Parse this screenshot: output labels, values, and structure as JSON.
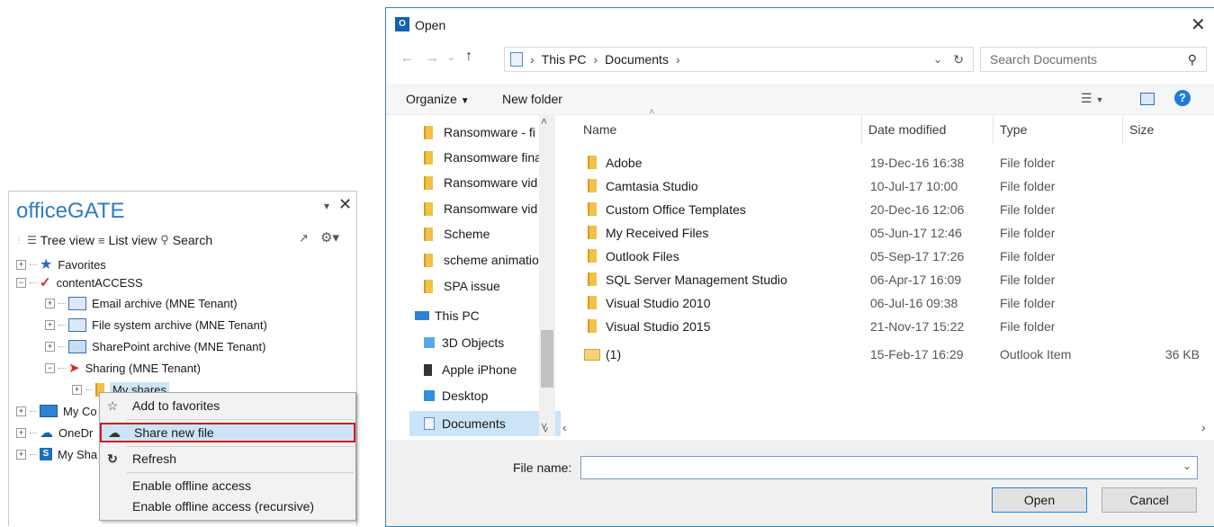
{
  "officegate": {
    "title": "officeGATE",
    "pin_icon": "pin-icon",
    "close_icon": "close-icon",
    "toolbar": {
      "tree_view": "Tree view",
      "list_view": "List view",
      "search": "Search"
    },
    "tree": [
      {
        "label": "Favorites",
        "icon": "star-icon"
      },
      {
        "label": "contentACCESS",
        "icon": "contentaccess-icon"
      },
      {
        "label": "Email archive (MNE Tenant)",
        "icon": "email-archive-icon"
      },
      {
        "label": "File system archive (MNE Tenant)",
        "icon": "filesystem-archive-icon"
      },
      {
        "label": "SharePoint archive (MNE Tenant)",
        "icon": "sharepoint-archive-icon"
      },
      {
        "label": "Sharing (MNE Tenant)",
        "icon": "sharing-icon"
      },
      {
        "label": "My shares",
        "icon": "folder-icon"
      },
      {
        "label": "My Co",
        "icon": "computer-icon"
      },
      {
        "label": "OneDr",
        "icon": "onedrive-icon"
      },
      {
        "label": "My Sha",
        "icon": "sharepoint-icon"
      }
    ]
  },
  "context_menu": {
    "items": [
      {
        "label": "Add to favorites",
        "icon": "star-outline-icon"
      },
      {
        "label": "Share new file",
        "icon": "cloud-upload-icon"
      },
      {
        "label": "Refresh",
        "icon": "refresh-icon"
      },
      {
        "label": "Enable offline access",
        "icon": ""
      },
      {
        "label": "Enable offline access (recursive)",
        "icon": ""
      }
    ]
  },
  "dialog": {
    "title": "Open",
    "address": {
      "crumbs": [
        "This PC",
        "Documents"
      ]
    },
    "search_placeholder": "Search Documents",
    "toolbar": {
      "organize": "Organize",
      "new_folder": "New folder"
    },
    "nav": [
      {
        "label": "Ransomware - fi",
        "type": "folder"
      },
      {
        "label": "Ransomware fina",
        "type": "folder"
      },
      {
        "label": "Ransomware vid",
        "type": "folder"
      },
      {
        "label": "Ransomware vid",
        "type": "folder"
      },
      {
        "label": "Scheme",
        "type": "folder"
      },
      {
        "label": "scheme animatio",
        "type": "folder"
      },
      {
        "label": "SPA issue",
        "type": "folder"
      },
      {
        "label": "This PC",
        "type": "pc"
      },
      {
        "label": "3D Objects",
        "type": "3d"
      },
      {
        "label": "Apple iPhone",
        "type": "phone"
      },
      {
        "label": "Desktop",
        "type": "desktop"
      },
      {
        "label": "Documents",
        "type": "documents"
      }
    ],
    "columns": {
      "name": "Name",
      "date": "Date modified",
      "type": "Type",
      "size": "Size"
    },
    "files": [
      {
        "name": "Adobe",
        "date": "19-Dec-16 16:38",
        "type": "File folder",
        "size": "",
        "icon": "folder-icon"
      },
      {
        "name": "Camtasia Studio",
        "date": "10-Jul-17 10:00",
        "type": "File folder",
        "size": "",
        "icon": "folder-icon"
      },
      {
        "name": "Custom Office Templates",
        "date": "20-Dec-16 12:06",
        "type": "File folder",
        "size": "",
        "icon": "folder-icon"
      },
      {
        "name": "My Received Files",
        "date": "05-Jun-17 12:46",
        "type": "File folder",
        "size": "",
        "icon": "folder-icon"
      },
      {
        "name": "Outlook Files",
        "date": "05-Sep-17 17:26",
        "type": "File folder",
        "size": "",
        "icon": "folder-icon"
      },
      {
        "name": "SQL Server Management Studio",
        "date": "06-Apr-17 16:09",
        "type": "File folder",
        "size": "",
        "icon": "folder-icon"
      },
      {
        "name": "Visual Studio 2010",
        "date": "06-Jul-16 09:38",
        "type": "File folder",
        "size": "",
        "icon": "folder-icon"
      },
      {
        "name": "Visual Studio 2015",
        "date": "21-Nov-17 15:22",
        "type": "File folder",
        "size": "",
        "icon": "folder-icon"
      },
      {
        "name": "(1)",
        "date": "15-Feb-17 16:29",
        "type": "Outlook Item",
        "size": "36 KB",
        "icon": "mail-icon"
      }
    ],
    "file_name_label": "File name:",
    "file_name_value": "",
    "open_button": "Open",
    "cancel_button": "Cancel"
  }
}
